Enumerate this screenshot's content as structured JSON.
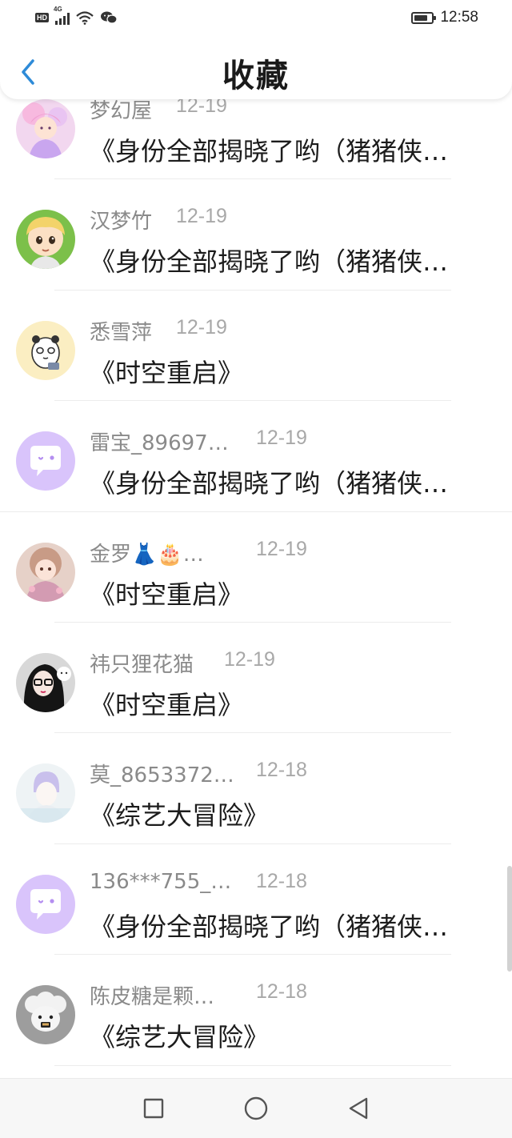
{
  "status_bar": {
    "hd": "HD",
    "network": "4G",
    "time": "12:58"
  },
  "header": {
    "title": "收藏",
    "back_icon": "chevron-left-icon",
    "accent": "#2e8bd8"
  },
  "items": [
    {
      "name": "梦幻屋",
      "date": "12-19",
      "content": "《身份全部揭晓了哟（猪猪侠…",
      "avatar": "fairy-girl"
    },
    {
      "name": "汉梦竹",
      "date": "12-19",
      "content": "《身份全部揭晓了哟（猪猪侠…",
      "avatar": "cartoon-boy"
    },
    {
      "name": "悉雪萍",
      "date": "12-19",
      "content": "《时空重启》",
      "avatar": "panda"
    },
    {
      "name": "雷宝_89697…",
      "date": "12-19",
      "content": "《身份全部揭晓了哟（猪猪侠…",
      "avatar": "default-chat"
    },
    {
      "name": "金罗👗🎂…",
      "date": "12-19",
      "content": "《时空重启》",
      "avatar": "doll"
    },
    {
      "name": "祎只狸花猫",
      "date": "12-19",
      "content": "《时空重启》",
      "avatar": "girl-glasses"
    },
    {
      "name": "莫_8653372…",
      "date": "12-18",
      "content": "《综艺大冒险》",
      "avatar": "pale-photo"
    },
    {
      "name": "136***755_…",
      "date": "12-18",
      "content": "《身份全部揭晓了哟（猪猪侠…",
      "avatar": "default-chat"
    },
    {
      "name": "陈皮糖是颗…",
      "date": "12-18",
      "content": "《综艺大冒险》",
      "avatar": "sheep-cartoon"
    }
  ],
  "system_nav": {
    "recent_icon": "square-icon",
    "home_icon": "circle-icon",
    "back_icon": "triangle-back-icon"
  }
}
